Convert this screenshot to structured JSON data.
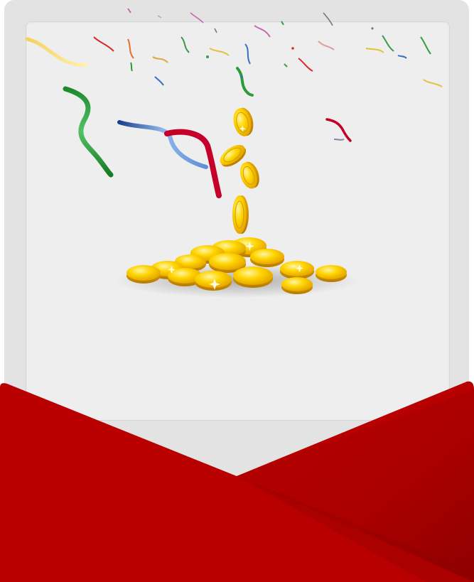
{
  "colors": {
    "envelope_red": "#b80000",
    "envelope_shadow": "#8f0000",
    "card_gray": "#e3e3e3",
    "panel_gray": "#eeeeee",
    "coin_gold": "#f5c400"
  },
  "icons": {
    "coins": "gold-coins-pile-icon",
    "confetti": "confetti-icon",
    "envelope": "red-envelope-icon"
  }
}
